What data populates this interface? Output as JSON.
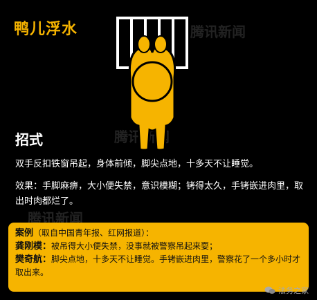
{
  "title": "鸭儿浮水",
  "watermark": "腾讯新闻",
  "section_title": "招式",
  "description": "双手反扣铁窗吊起，身体前倾，脚尖点地，十多天不让睡觉。",
  "effect": "效果：手脚麻痹，大小便失禁，意识模糊；铐得太久，手铐嵌进肉里，取出时肉都烂了。",
  "case": {
    "label": "案例",
    "source": "（取自中国青年报、红网报道）：",
    "rows": [
      {
        "name": "龚刚模：",
        "text": "被吊得大小便失禁，没事就被警察吊起来耍；"
      },
      {
        "name": "樊奇航：",
        "text": "脚尖点地，十多天不让睡觉。手铐嵌进肉里，警察花了一个多小时才取出来。"
      }
    ]
  },
  "footer": {
    "account": "法务之家"
  },
  "colors": {
    "accent": "#f6b400",
    "background": "#000000"
  }
}
